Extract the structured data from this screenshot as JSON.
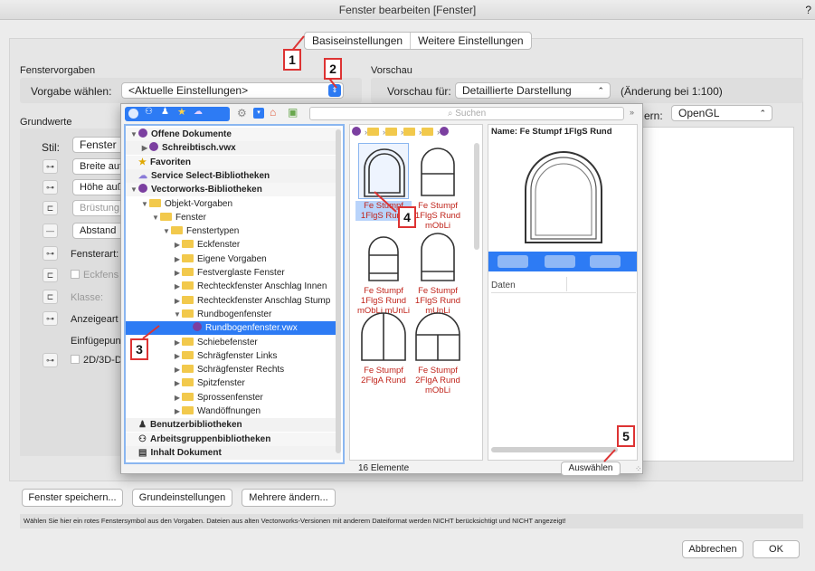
{
  "window": {
    "title": "Fenster bearbeiten [Fenster]",
    "help": "?"
  },
  "tabs": [
    {
      "label": "Basiseinstellungen"
    },
    {
      "label": "Weitere Einstellungen"
    }
  ],
  "fenstervorgaben": {
    "heading": "Fenstervorgaben",
    "label": "Vorgabe wählen:",
    "value": "<Aktuelle Einstellungen>"
  },
  "vorschau": {
    "heading": "Vorschau",
    "label": "Vorschau für:",
    "value": "Detaillierte Darstellung",
    "scale": "(Änderung bei 1:100)",
    "render_label": "ern:",
    "render_value": "OpenGL"
  },
  "grundwerte": {
    "heading": "Grundwerte",
    "stil_label": "Stil:",
    "stil_value": "Fenster",
    "breite": "Breite auf",
    "hoehe": "Höhe auß",
    "bruestung": "Brüstung",
    "abstand": "Abstand",
    "fensterart": "Fensterart:",
    "eckfenster": "Eckfens",
    "klasse": "Klasse:",
    "anzeigeart": "Anzeigeart",
    "einfuegepunkt": "Einfügepun",
    "darstellung": "2D/3D-D"
  },
  "browser": {
    "search_placeholder": "Suchen",
    "tree": [
      {
        "label": "Offene Dokumente",
        "bold": true,
        "icon": "vw",
        "open": true,
        "level": 0
      },
      {
        "label": "Schreibtisch.vwx",
        "bold": true,
        "icon": "vw",
        "open": false,
        "level": 1
      },
      {
        "label": "Favoriten",
        "bold": true,
        "icon": "star",
        "level": 0
      },
      {
        "label": "Service Select-Bibliotheken",
        "bold": true,
        "icon": "cloud",
        "level": 0
      },
      {
        "label": "Vectorworks-Bibliotheken",
        "bold": true,
        "icon": "vw",
        "open": true,
        "level": 0
      },
      {
        "label": "Objekt-Vorgaben",
        "icon": "folder",
        "open": true,
        "level": 1
      },
      {
        "label": "Fenster",
        "icon": "folder",
        "open": true,
        "level": 2
      },
      {
        "label": "Fenstertypen",
        "icon": "folder",
        "open": true,
        "level": 3
      },
      {
        "label": "Eckfenster",
        "icon": "folder",
        "open": false,
        "level": 4
      },
      {
        "label": "Eigene Vorgaben",
        "icon": "folder",
        "open": false,
        "level": 4
      },
      {
        "label": "Festverglaste Fenster",
        "icon": "folder",
        "open": false,
        "level": 4
      },
      {
        "label": "Rechteckfenster Anschlag Innen",
        "icon": "folder",
        "open": false,
        "level": 4
      },
      {
        "label": "Rechteckfenster Anschlag Stump",
        "icon": "folder",
        "open": false,
        "level": 4
      },
      {
        "label": "Rundbogenfenster",
        "icon": "folder",
        "open": true,
        "level": 4
      },
      {
        "label": "Rundbogenfenster.vwx",
        "icon": "vw",
        "level": 5,
        "selected": true
      },
      {
        "label": "Schiebefenster",
        "icon": "folder",
        "open": false,
        "level": 4
      },
      {
        "label": "Schrägfenster Links",
        "icon": "folder",
        "open": false,
        "level": 4
      },
      {
        "label": "Schrägfenster Rechts",
        "icon": "folder",
        "open": false,
        "level": 4
      },
      {
        "label": "Spitzfenster",
        "icon": "folder",
        "open": false,
        "level": 4
      },
      {
        "label": "Sprossenfenster",
        "icon": "folder",
        "open": false,
        "level": 4
      },
      {
        "label": "Wandöffnungen",
        "icon": "folder",
        "open": false,
        "level": 4
      },
      {
        "label": "Benutzerbibliotheken",
        "bold": true,
        "icon": "user",
        "level": 0
      },
      {
        "label": "Arbeitsgruppenbibliotheken",
        "bold": true,
        "icon": "group",
        "level": 0
      },
      {
        "label": "Inhalt Dokument",
        "bold": true,
        "icon": "doc",
        "level": 0
      }
    ],
    "items": [
      {
        "label": "Fe Stumpf 1FlgS Rund",
        "selected": true
      },
      {
        "label": "Fe Stumpf 1FlgS Rund mObLi"
      },
      {
        "label": "Fe Stumpf 1FlgS Rund mObLi mUnLi"
      },
      {
        "label": "Fe Stumpf 1FlgS Rund mUnLi"
      },
      {
        "label": "Fe Stumpf 2FlgA Rund"
      },
      {
        "label": "Fe Stumpf 2FlgA Rund mObLi"
      }
    ],
    "preview_name": "Name: Fe Stumpf 1FlgS Rund",
    "data_header": "Daten",
    "count": "16 Elemente",
    "select_button": "Auswählen"
  },
  "bottom": {
    "save": "Fenster speichern...",
    "defaults": "Grundeinstellungen",
    "multi": "Mehrere ändern...",
    "hint": "Wählen Sie hier ein rotes Fenstersymbol aus den Vorgaben. Dateien aus alten Vectorworks-Versionen mit anderem Dateiformat werden NICHT berücksichtigt und NICHT angezeigt!",
    "cancel": "Abbrechen",
    "ok": "OK"
  },
  "markers": [
    "1",
    "2",
    "3",
    "4",
    "5"
  ]
}
